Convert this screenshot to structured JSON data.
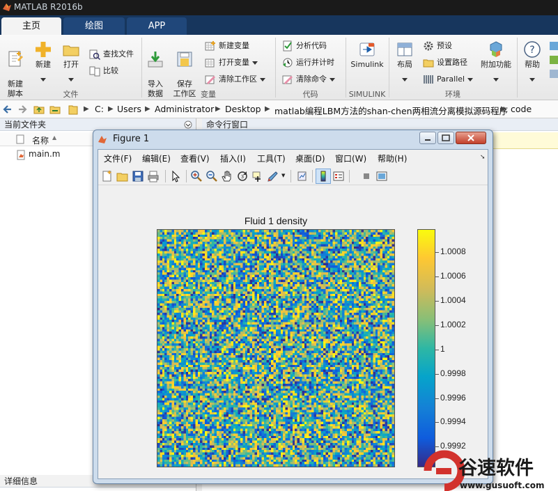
{
  "app_title": "MATLAB R2016b",
  "tabs": [
    {
      "label": "主页",
      "active": true
    },
    {
      "label": "绘图",
      "active": false
    },
    {
      "label": "APP",
      "active": false
    }
  ],
  "ribbon": {
    "new_script": "新建\n脚本",
    "new": "新建",
    "open": "打开",
    "find_files": "查找文件",
    "compare": "比较",
    "import_data": "导入\n数据",
    "save_workspace": "保存\n工作区",
    "new_variable": "新建变量",
    "open_variable": "打开变量",
    "clear_workspace": "清除工作区",
    "analyze_code": "分析代码",
    "run_and_time": "运行并计时",
    "clear_commands": "清除命令",
    "simulink": "Simulink",
    "layout": "布局",
    "preferences": "预设",
    "set_path": "设置路径",
    "parallel": "Parallel",
    "addons": "附加功能",
    "help": "帮助",
    "groups": {
      "file": "文件",
      "variable": "变量",
      "code": "代码",
      "simulink": "SIMULINK",
      "environment": "环境"
    }
  },
  "address": {
    "crumbs": [
      "C:",
      "Users",
      "Administrator",
      "Desktop",
      "matlab编程LBM方法的shan-chen两相流分离模拟源码程序",
      "code"
    ]
  },
  "left_panel": {
    "title": "当前文件夹",
    "col_name": "名称",
    "files": [
      "main.m"
    ],
    "details": "详细信息"
  },
  "command_window": {
    "title": "命令行窗口"
  },
  "figure": {
    "title": "Figure 1",
    "menu": [
      "文件(F)",
      "编辑(E)",
      "查看(V)",
      "插入(I)",
      "工具(T)",
      "桌面(D)",
      "窗口(W)",
      "帮助(H)"
    ],
    "plot_title": "Fluid 1 density"
  },
  "chart_data": {
    "type": "heatmap",
    "title": "Fluid 1 density",
    "colorbar_ticks": [
      "0.9992",
      "0.9994",
      "0.9996",
      "0.9998",
      "1",
      "1.0002",
      "1.0004",
      "1.0006",
      "1.0008"
    ],
    "colorbar_tick_values": [
      0.9992,
      0.9994,
      0.9996,
      0.9998,
      1,
      1.0002,
      1.0004,
      1.0006,
      1.0008
    ],
    "clim": [
      0.99903,
      1.00099
    ],
    "grid_size": [
      100,
      100
    ],
    "colormap": "parula"
  },
  "watermark": {
    "brand": "谷速软件",
    "url": "www.gusuoft.com"
  },
  "colors": {
    "tabbar": "#17365d",
    "active_tab": "#f3f3f3",
    "titlebar": "#1a1a1a"
  }
}
